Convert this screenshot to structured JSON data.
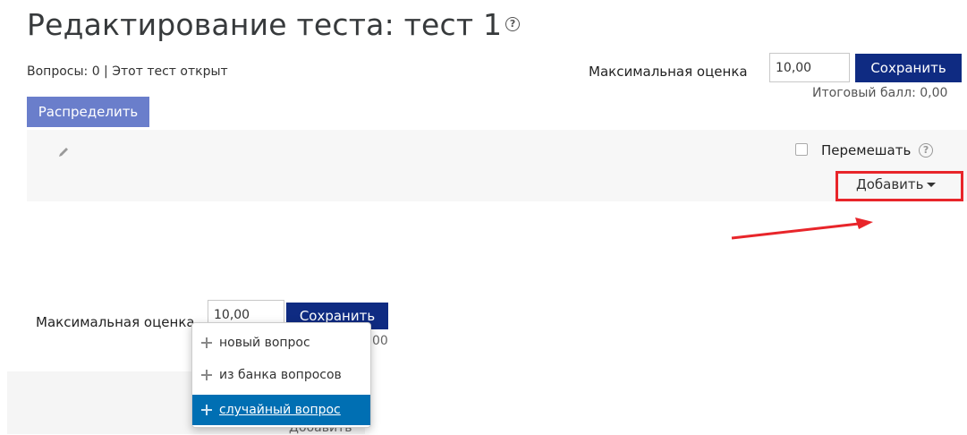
{
  "page": {
    "title": "Редактирование теста: тест 1",
    "help_glyph": "?",
    "status": "Вопросы: 0 | Этот тест открыт"
  },
  "grading": {
    "max_label": "Максимальная оценка",
    "max_value": "10,00",
    "save_label": "Сохранить",
    "total_label": "Итоговый балл: 0,00"
  },
  "repaginate_label": "Распределить",
  "section": {
    "shuffle_label": "Перемешать",
    "shuffle_checked": false,
    "add_label": "Добавить"
  },
  "lower_panel": {
    "max_label": "Максимальная оценка",
    "max_value": "10,00",
    "save_label": "Сохранить",
    "total_fragment": "00",
    "add_fragment": "Добавить"
  },
  "add_menu": {
    "items": [
      {
        "label": "новый вопрос",
        "icon": "plus-icon",
        "active": false
      },
      {
        "label": "из банка вопросов",
        "icon": "plus-icon",
        "active": false
      },
      {
        "label": "случайный вопрос",
        "icon": "plus-icon",
        "active": true
      }
    ]
  },
  "colors": {
    "save_button": "#0f2b82",
    "repaginate_button": "#6a7ecb",
    "highlight_box": "#e8252a",
    "menu_active": "#006fb3"
  }
}
